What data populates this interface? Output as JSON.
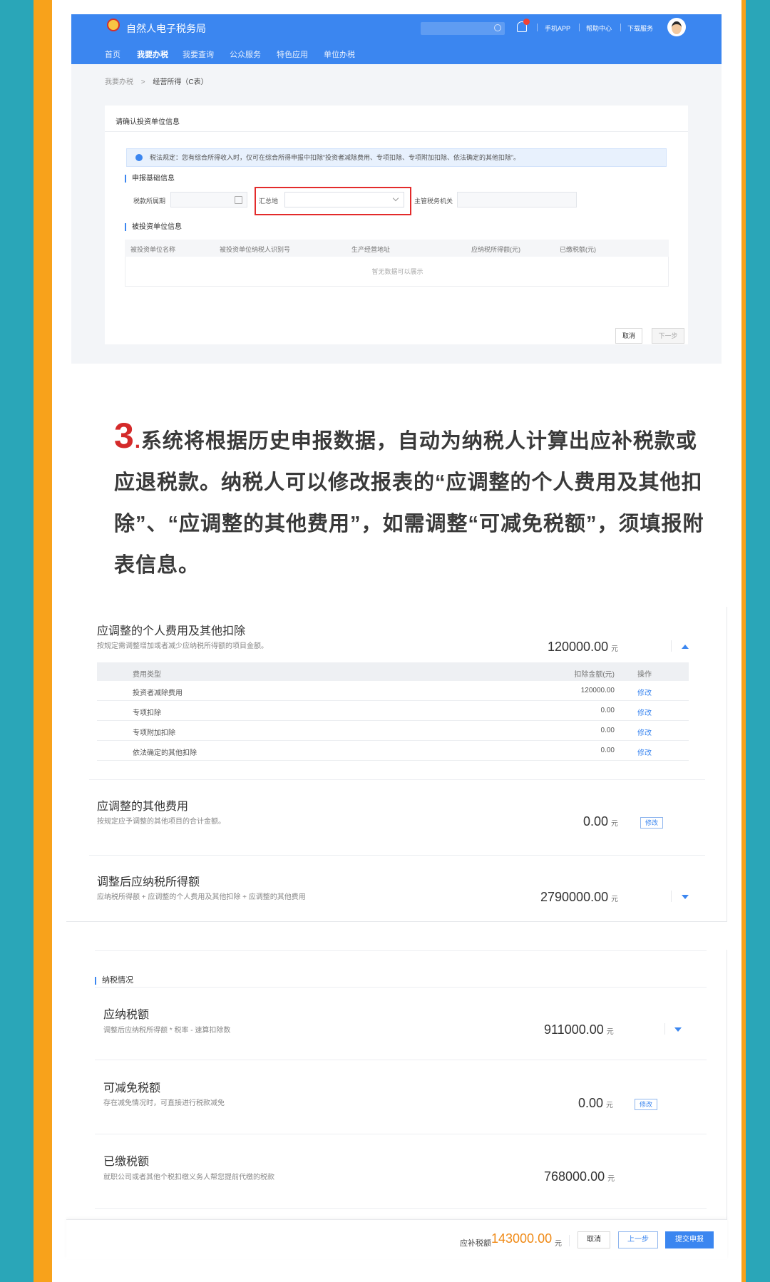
{
  "colors": {
    "teal_bg": "#2aa6b8",
    "orange_stripe": "#f8a21b",
    "brand_blue": "#3b86f0",
    "highlight_red": "#e32b2b",
    "amount_orange": "#f08a16"
  },
  "portal": {
    "site_name": "自然人电子税务局",
    "header_links": [
      "手机APP",
      "帮助中心",
      "下载服务"
    ],
    "nav": [
      "首页",
      "我要办税",
      "我要查询",
      "公众服务",
      "特色应用",
      "单位办税"
    ],
    "breadcrumb": {
      "parent": "我要办税",
      "sep": ">",
      "current": "经营所得（C表）"
    },
    "card_title": "请确认投资单位信息",
    "notice": "税法规定：您有综合所得收入时，仅可在综合所得申报中扣除“投资者减除费用、专项扣除、专项附加扣除、依法确定的其他扣除”。",
    "section_basic": "申报基础信息",
    "field_period": "税款所属期",
    "field_summary_place": "汇总地",
    "field_tax_office": "主管税务机关",
    "section_invested": "被投资单位信息",
    "table_headers": [
      "被投资单位名称",
      "被投资单位纳税人识别号",
      "生产经营地址",
      "应纳税所得额(元)",
      "已缴税额(元)"
    ],
    "empty_text": "暂无数据可以展示",
    "btn_cancel": "取消",
    "btn_next": "下一步"
  },
  "step": {
    "number": "3",
    "dot": ".",
    "text": "系统将根据历史申报数据，自动为纳税人计算出应补税款或应退税款。纳税人可以修改报表的“应调整的个人费用及其他扣除”、“应调整的其他费用”，如需调整“可减免税额”，须填报附表信息。"
  },
  "adjust": {
    "personal": {
      "title": "应调整的个人费用及其他扣除",
      "desc": "按规定需调整增加或者减少应纳税所得额的项目金额。",
      "amount": "120000.00",
      "unit": "元",
      "col_type": "费用类型",
      "col_amount": "扣除金额(元)",
      "col_op": "操作",
      "rows": [
        {
          "type": "投资者减除费用",
          "amount": "120000.00",
          "op": "修改"
        },
        {
          "type": "专项扣除",
          "amount": "0.00",
          "op": "修改"
        },
        {
          "type": "专项附加扣除",
          "amount": "0.00",
          "op": "修改"
        },
        {
          "type": "依法确定的其他扣除",
          "amount": "0.00",
          "op": "修改"
        }
      ]
    },
    "other": {
      "title": "应调整的其他费用",
      "desc": "按规定应予调整的其他项目的合计金额。",
      "amount": "0.00",
      "unit": "元",
      "edit": "修改"
    },
    "taxable": {
      "title": "调整后应纳税所得额",
      "desc": "应纳税所得额 + 应调整的个人费用及其他扣除 + 应调整的其他费用",
      "amount": "2790000.00",
      "unit": "元"
    }
  },
  "tax": {
    "section": "纳税情况",
    "payable": {
      "title": "应纳税额",
      "desc": "调整后应纳税所得额 * 税率 - 速算扣除数",
      "amount": "911000.00",
      "unit": "元"
    },
    "reducible": {
      "title": "可减免税额",
      "desc": "存在减免情况时，可直接进行税款减免",
      "amount": "0.00",
      "unit": "元",
      "edit": "修改"
    },
    "paid": {
      "title": "已缴税额",
      "desc": "就职公司或者其他个税扣缴义务人帮您提前代缴的税款",
      "amount": "768000.00",
      "unit": "元"
    }
  },
  "footer": {
    "label": "应补税额",
    "amount": "143000.00",
    "unit": "元",
    "cancel": "取消",
    "prev": "上一步",
    "submit": "提交申报"
  }
}
